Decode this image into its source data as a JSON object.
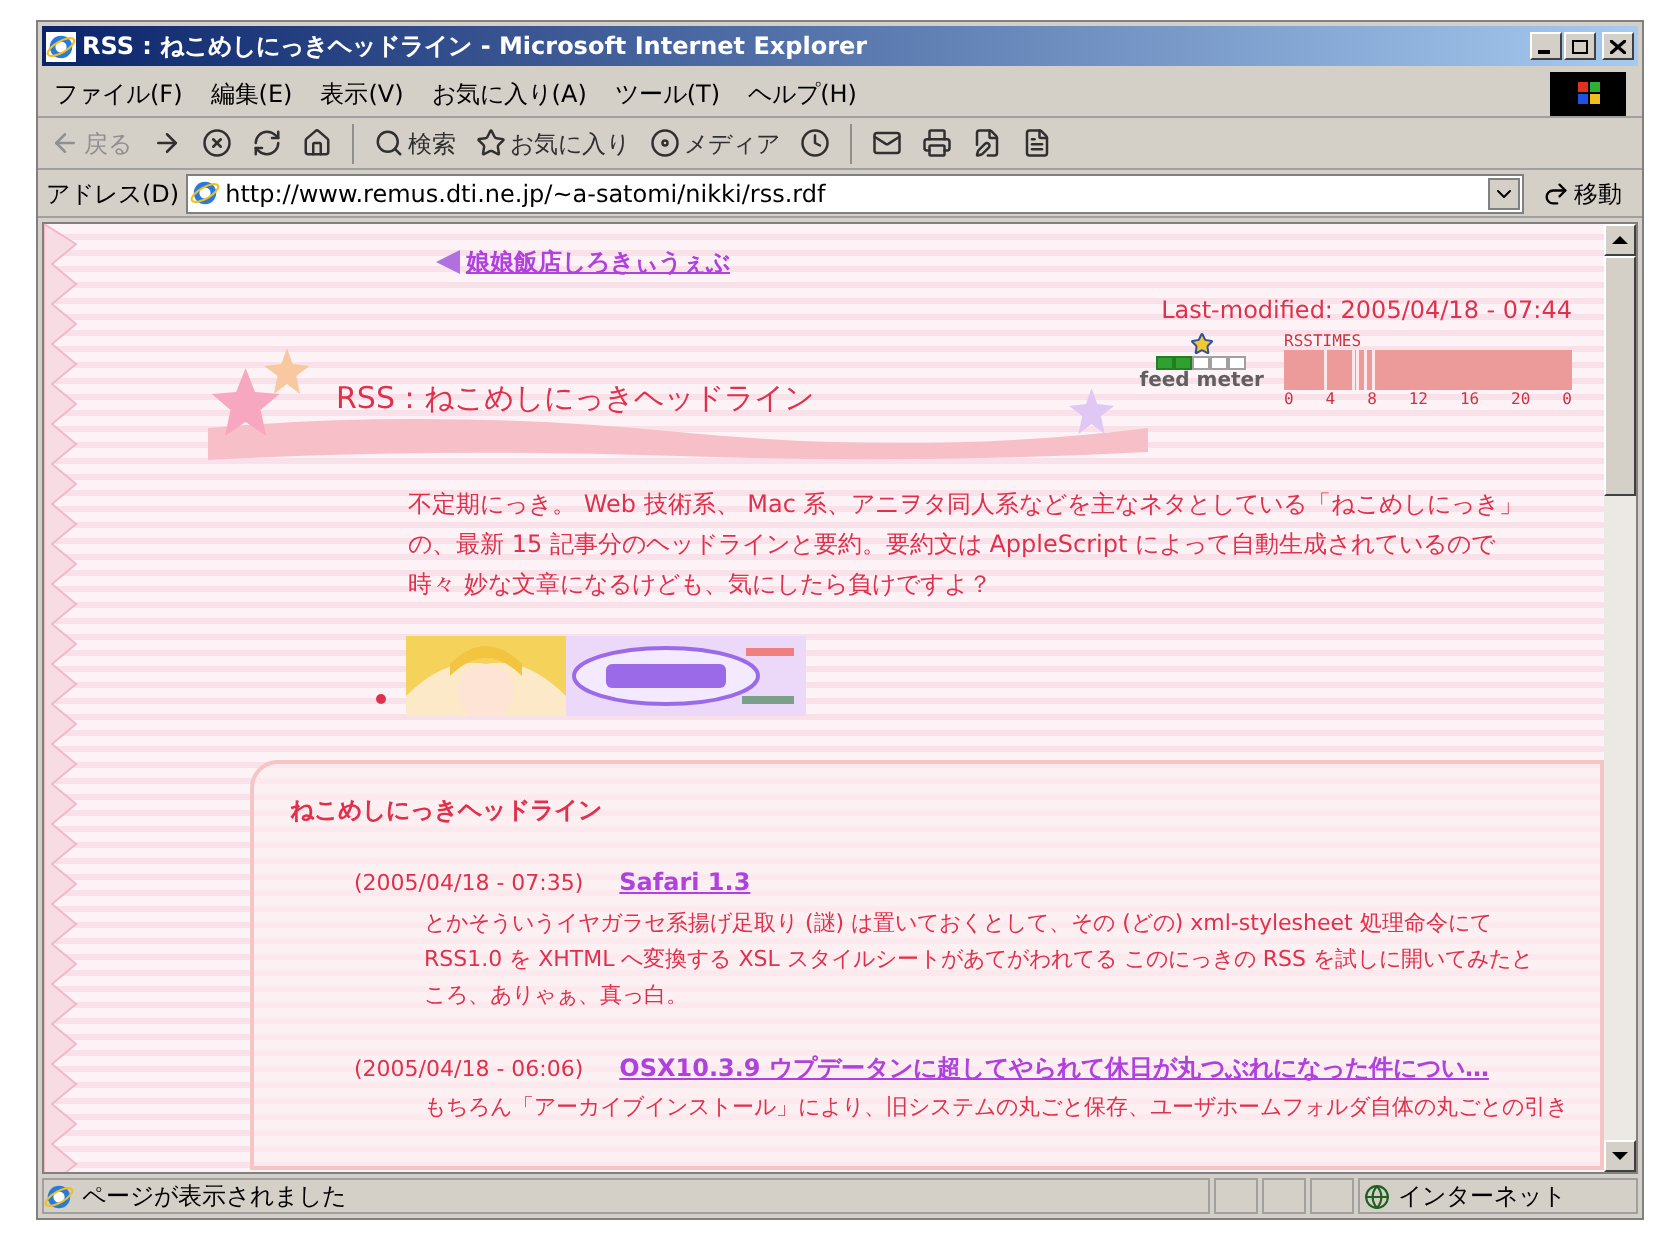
{
  "window": {
    "title": "RSS : ねこめしにっきヘッドライン - Microsoft Internet Explorer"
  },
  "menu": [
    "ファイル(F)",
    "編集(E)",
    "表示(V)",
    "お気に入り(A)",
    "ツール(T)",
    "ヘルプ(H)"
  ],
  "toolbar": [
    {
      "kind": "back",
      "label": "戻る",
      "disabled": true
    },
    {
      "kind": "forward",
      "disabled": false
    },
    {
      "kind": "stop",
      "disabled": false
    },
    {
      "kind": "refresh",
      "disabled": false
    },
    {
      "kind": "home",
      "disabled": false
    },
    {
      "kind": "search",
      "label": "検索",
      "disabled": false
    },
    {
      "kind": "favorites",
      "label": "お気に入り",
      "disabled": false
    },
    {
      "kind": "media",
      "label": "メディア",
      "disabled": false
    },
    {
      "kind": "history",
      "disabled": false
    },
    {
      "kind": "mail",
      "disabled": false
    },
    {
      "kind": "print",
      "disabled": false
    },
    {
      "kind": "edit",
      "disabled": false
    },
    {
      "kind": "discuss",
      "disabled": false
    }
  ],
  "address": {
    "label": "アドレス(D)",
    "url": "http://www.remus.dti.ne.jp/~a-satomi/nikki/rss.rdf",
    "go": "移動"
  },
  "page": {
    "nav_link": "娘娘飯店しろきぃうぇぶ",
    "last_modified": "Last-modified: 2005/04/18 - 07:44",
    "feed_meter": {
      "label": "feed meter",
      "level": 0.4
    },
    "rss_times": {
      "title": "RSSTIMES",
      "ticks": [
        "0",
        "4",
        "8",
        "12",
        "16",
        "20",
        "0"
      ]
    },
    "heading": "RSS : ねこめしにっきヘッドライン",
    "description": [
      "不定期にっき。 Web 技術系、 Mac 系、アニヲタ同人系などを主なネタとしている「ねこめしにっき」",
      "の、最新 15 記事分のヘッドラインと要約。要約文は AppleScript によって自動生成されているので",
      "時々 妙な文章になるけども、気にしたら負けですよ？"
    ],
    "headlines": {
      "title": "ねこめしにっきヘッドライン",
      "items": [
        {
          "date": "(2005/04/18 - 07:35)",
          "title": "Safari 1.3",
          "summary": [
            "とかそういうイヤガラセ系揚げ足取り (謎) は置いておくとして、その (どの) xml-stylesheet 処理命令にて",
            "RSS1.0 を XHTML へ変換する XSL スタイルシートがあてがわれてる このにっきの RSS を試しに開いてみたと",
            "ころ、ありゃぁ、真っ白。"
          ]
        },
        {
          "date": "(2005/04/18 - 06:06)",
          "title": "OSX10.3.9 ウプデータンに超してやられて休日が丸つぶれになった件につい…",
          "summary": [
            "もちろん「アーカイブインストール」により、旧システムの丸ごと保存、ユーザホームフォルダ自体の丸ごとの引き"
          ]
        }
      ]
    }
  },
  "status_bar": {
    "text": "ページが表示されました",
    "zone": "インターネット"
  }
}
